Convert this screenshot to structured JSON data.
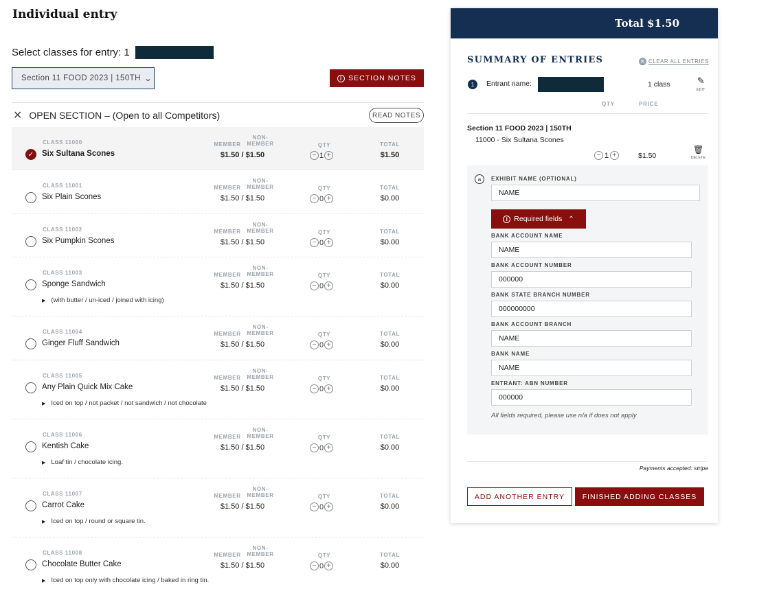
{
  "page": {
    "title": "Individual entry",
    "select_prefix": "Select classes for entry: 1",
    "section_dropdown": "Section 11 FOOD 2023 | 150TH",
    "section_notes_label": "SECTION NOTES"
  },
  "open_section": {
    "label": "OPEN SECTION – (Open to all Competitors)",
    "read_notes_label": "READ NOTES"
  },
  "column_headers": {
    "member": "MEMBER",
    "non_member_line1": "NON-",
    "non_member_line2": "MEMBER",
    "qty": "QTY",
    "total": "TOTAL"
  },
  "classes": [
    {
      "code": "CLASS 11000",
      "name": "Six Sultana Scones",
      "price": "$1.50 / $1.50",
      "qty": "1",
      "total": "$1.50",
      "selected": true,
      "desc": ""
    },
    {
      "code": "CLASS 11001",
      "name": "Six Plain Scones",
      "price": "$1.50 / $1.50",
      "qty": "0",
      "total": "$0.00",
      "selected": false,
      "desc": ""
    },
    {
      "code": "CLASS 11002",
      "name": "Six Pumpkin Scones",
      "price": "$1.50 / $1.50",
      "qty": "0",
      "total": "$0.00",
      "selected": false,
      "desc": ""
    },
    {
      "code": "CLASS 11003",
      "name": "Sponge Sandwich",
      "price": "$1.50 / $1.50",
      "qty": "0",
      "total": "$0.00",
      "selected": false,
      "desc": "(with butter / un-iced / joined with icing)"
    },
    {
      "code": "CLASS 11004",
      "name": "Ginger Fluff Sandwich",
      "price": "$1.50 / $1.50",
      "qty": "0",
      "total": "$0.00",
      "selected": false,
      "desc": ""
    },
    {
      "code": "CLASS 11005",
      "name": "Any Plain Quick Mix Cake",
      "price": "$1.50 / $1.50",
      "qty": "0",
      "total": "$0.00",
      "selected": false,
      "desc": "Iced on top / not packet / not sandwich / not chocolate"
    },
    {
      "code": "CLASS 11006",
      "name": "Kentish Cake",
      "price": "$1.50 / $1.50",
      "qty": "0",
      "total": "$0.00",
      "selected": false,
      "desc": "Loaf tin / chocolate icing."
    },
    {
      "code": "CLASS 11007",
      "name": "Carrot Cake",
      "price": "$1.50 / $1.50",
      "qty": "0",
      "total": "$0.00",
      "selected": false,
      "desc": "Iced on top / round or square tin."
    },
    {
      "code": "CLASS 11008",
      "name": "Chocolate Butter Cake",
      "price": "$1.50 / $1.50",
      "qty": "0",
      "total": "$0.00",
      "selected": false,
      "desc": "Iced on top only with chocolate icing / baked in ring tin."
    }
  ],
  "summary": {
    "total_label": "Total $1.50",
    "title": "SUMMARY OF ENTRIES",
    "clear_all": "CLEAR ALL ENTRIES",
    "entry_number": "1",
    "entrant_label": "Entrant name:",
    "class_count": "1 class",
    "edit_label": "EDIT",
    "qty_header": "QTY",
    "price_header": "PRICE",
    "section_title": "Section 11 FOOD 2023 | 150TH",
    "item": "11000 - Six Sultana Scones",
    "item_qty": "1",
    "item_price": "$1.50",
    "delete_label": "DELETE",
    "exhibit_letter": "a",
    "exhibit_label": "EXHIBIT NAME (OPTIONAL)",
    "exhibit_value": "NAME",
    "required_label": "Required fields",
    "fields": [
      {
        "label": "BANK ACCOUNT NAME",
        "value": "NAME"
      },
      {
        "label": "BANK ACCOUNT NUMBER",
        "value": "000000"
      },
      {
        "label": "BANK STATE BRANCH NUMBER",
        "value": "000000000"
      },
      {
        "label": "BANK ACCOUNT BRANCH",
        "value": "NAME"
      },
      {
        "label": "BANK NAME",
        "value": "NAME"
      },
      {
        "label": "ENTRANT: ABN NUMBER",
        "value": "000000"
      }
    ],
    "fields_note": "All fields required, please use n/a if does not apply",
    "payments": "Payments accepted: stripe",
    "add_another_label": "ADD ANOTHER ENTRY",
    "finished_label": "FINISHED ADDING CLASSES"
  },
  "colors": {
    "navy": "#142f52",
    "crimson": "#8b0e0e",
    "redaction": "#0f2a38"
  },
  "icons": {
    "check": "check-icon",
    "close": "close-icon",
    "chevron": "chevron-down-icon",
    "info": "info-icon",
    "edit": "pencil-icon",
    "delete": "trash-icon",
    "minus": "minus-circle-icon",
    "plus": "plus-circle-icon"
  }
}
